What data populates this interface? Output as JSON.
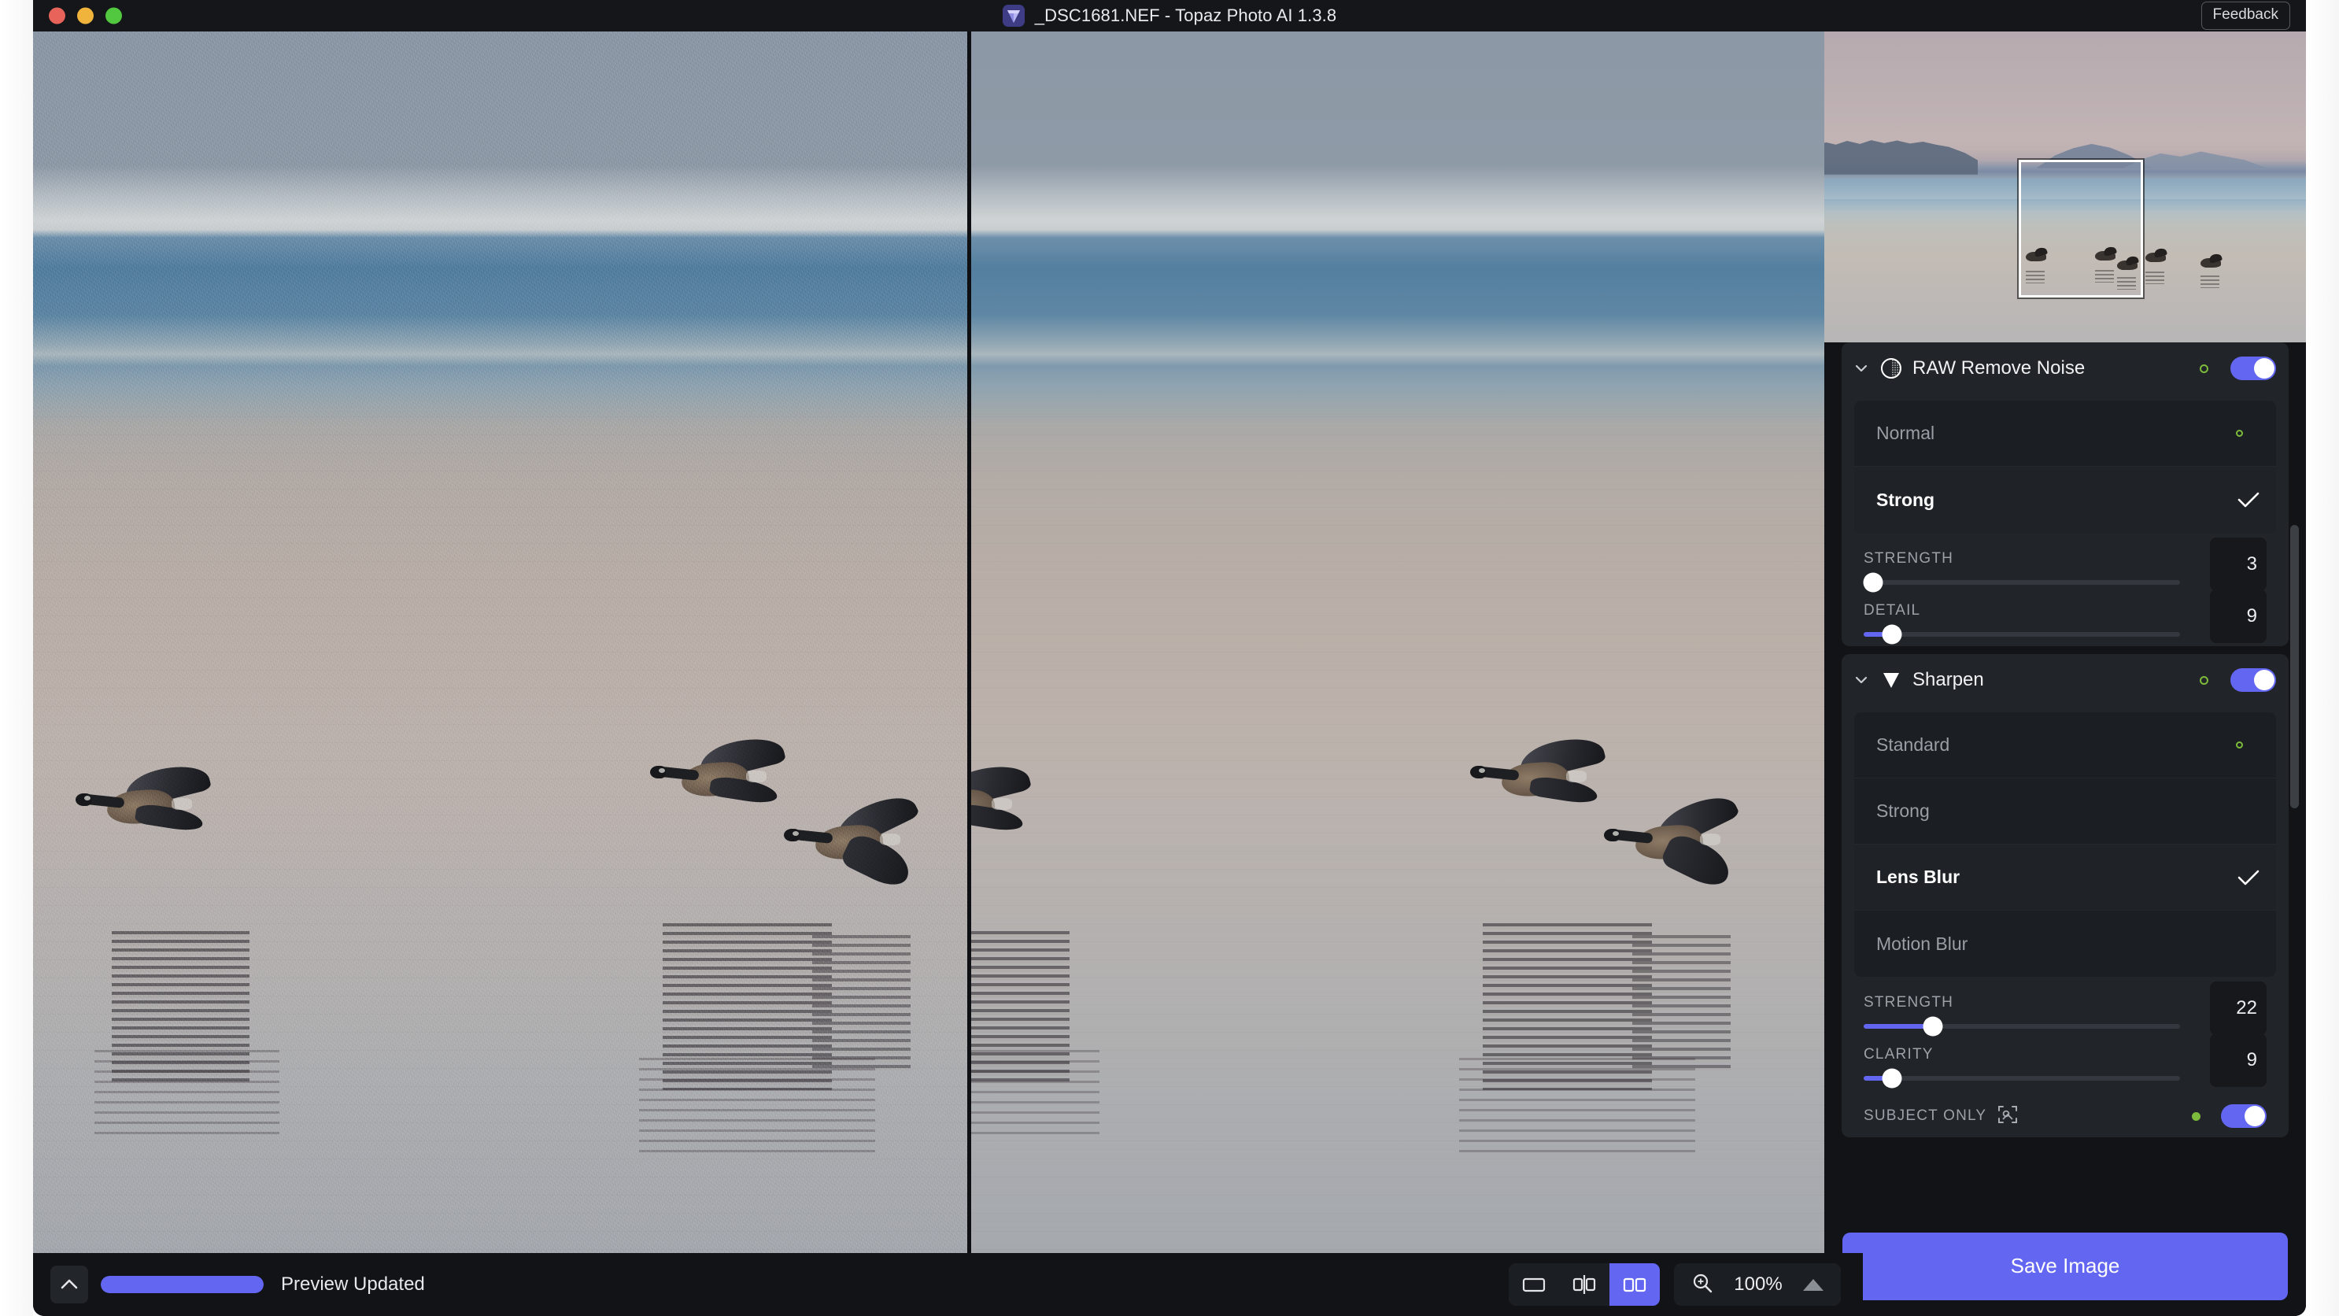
{
  "window": {
    "title": "_DSC1681.NEF - Topaz Photo AI 1.3.8",
    "app_icon": "purple-gem-icon",
    "feedback_label": "Feedback",
    "traffic_lights": [
      "close",
      "minimize",
      "zoom"
    ]
  },
  "colors": {
    "accent_purple": "#6366f1",
    "panel_bg": "#111316",
    "card_bg": "#212428",
    "indicator_green": "#7dbb3c",
    "traffic_red": "#e8645a",
    "traffic_yellow": "#f0b43c",
    "traffic_green": "#51c83f"
  },
  "navigator": {
    "name": "image-navigator-thumbnail",
    "viewport_rect": true
  },
  "viewer": {
    "left_pane": "original",
    "right_pane": "processed",
    "comparison_mode": "side-by-side"
  },
  "panel": {
    "filters": [
      {
        "id": "raw-remove-noise",
        "title": "RAW Remove Noise",
        "icon": "noise-circle-icon",
        "enabled": true,
        "auto_dot": true,
        "models": [
          {
            "label": "Normal",
            "selected": false,
            "auto_dot": true
          },
          {
            "label": "Strong",
            "selected": true,
            "auto_dot": false
          }
        ],
        "sliders": [
          {
            "label": "Strength",
            "value": "3",
            "percent": 3
          },
          {
            "label": "Detail",
            "value": "9",
            "percent": 9
          }
        ]
      },
      {
        "id": "sharpen",
        "title": "Sharpen",
        "icon": "sharpen-triangle-icon",
        "enabled": true,
        "auto_dot": true,
        "models": [
          {
            "label": "Standard",
            "selected": false,
            "auto_dot": true
          },
          {
            "label": "Strong",
            "selected": false,
            "auto_dot": false
          },
          {
            "label": "Lens Blur",
            "selected": true,
            "auto_dot": false
          },
          {
            "label": "Motion Blur",
            "selected": false,
            "auto_dot": false
          }
        ],
        "sliders": [
          {
            "label": "Strength",
            "value": "22",
            "percent": 22
          },
          {
            "label": "Clarity",
            "value": "9",
            "percent": 9
          }
        ],
        "subject_only": {
          "label": "Subject Only",
          "icon": "subject-mask-icon",
          "enabled": true,
          "auto_dot": true
        }
      }
    ],
    "save_label": "Save Image"
  },
  "statusbar": {
    "collapse_icon": "chevron-up-icon",
    "progress_percent": 100,
    "status_text": "Preview Updated",
    "view_modes": [
      {
        "id": "single",
        "icon": "single-view-icon",
        "active": false
      },
      {
        "id": "split",
        "icon": "split-view-icon",
        "active": false
      },
      {
        "id": "side-by-side",
        "icon": "side-by-side-view-icon",
        "active": true
      }
    ],
    "zoom_icon": "magnifier-plus-icon",
    "zoom_level": "100%",
    "zoom_menu_icon": "triangle-up-icon"
  }
}
